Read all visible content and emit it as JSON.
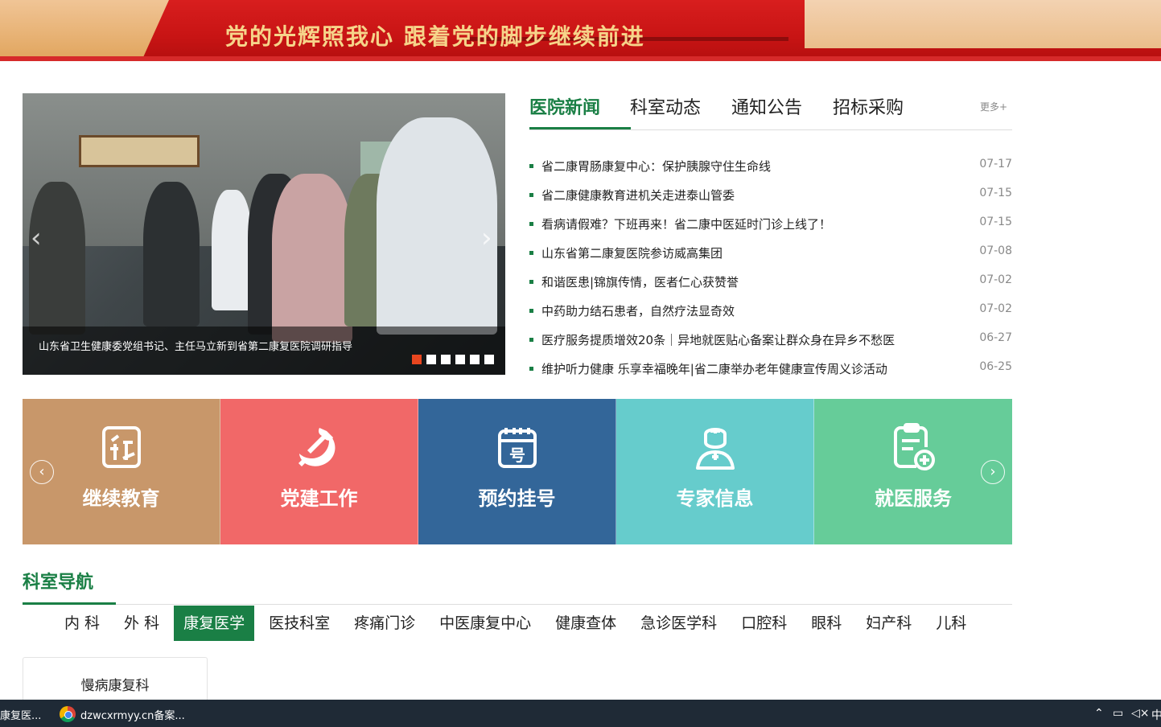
{
  "banner": {
    "slogan": "党的光辉照我心  跟着党的脚步继续前进"
  },
  "slider": {
    "caption": "山东省卫生健康委党组书记、主任马立新到省第二康复医院调研指导",
    "prev_icon": "chevron-left-icon",
    "next_icon": "chevron-right-icon",
    "active_index": 1,
    "dot_count": 6
  },
  "news": {
    "tabs": [
      "医院新闻",
      "科室动态",
      "通知公告",
      "招标采购"
    ],
    "active_tab": "医院新闻",
    "more": "更多+",
    "items": [
      {
        "title": "省二康胃肠康复中心：保护胰腺守住生命线",
        "date": "07-17"
      },
      {
        "title": "省二康健康教育进机关走进泰山管委",
        "date": "07-15"
      },
      {
        "title": "看病请假难？下班再来！省二康中医延时门诊上线了！",
        "date": "07-15"
      },
      {
        "title": "山东省第二康复医院参访威高集团",
        "date": "07-08"
      },
      {
        "title": "和谐医患|锦旗传情，医者仁心获赞誉",
        "date": "07-02"
      },
      {
        "title": "中药助力结石患者，自然疗法显奇效",
        "date": "07-02"
      },
      {
        "title": "医疗服务提质增效20条｜异地就医贴心备案让群众身在异乡不愁医",
        "date": "06-27"
      },
      {
        "title": "维护听力健康 乐享幸福晚年|省二康举办老年健康宣传周义诊活动",
        "date": "06-25"
      }
    ]
  },
  "tiles": [
    {
      "label": "继续教育",
      "icon": "book-reading-icon",
      "color": "#c8976a"
    },
    {
      "label": "党建工作",
      "icon": "hammer-sickle-icon",
      "color": "#f16868"
    },
    {
      "label": "预约挂号",
      "icon": "calendar-register-icon",
      "color": "#336699"
    },
    {
      "label": "专家信息",
      "icon": "doctor-icon",
      "color": "#66cccc"
    },
    {
      "label": "就医服务",
      "icon": "clipboard-plus-icon",
      "color": "#66cc99"
    }
  ],
  "dept": {
    "title": "科室导航",
    "tabs": [
      "内 科",
      "外 科",
      "康复医学",
      "医技科室",
      "疼痛门诊",
      "中医康复中心",
      "健康查体",
      "急诊医学科",
      "口腔科",
      "眼科",
      "妇产科",
      "儿科"
    ],
    "active_tab": "康复医学",
    "card": "慢病康复科"
  },
  "taskbar": {
    "task1": "康复医...",
    "task2": "dzwcxrmyy.cn备案...",
    "ime": "中"
  },
  "colors": {
    "brand_green": "#1a7f45",
    "banner_red": "#c81414",
    "slider_dot_active": "#e8461f"
  }
}
